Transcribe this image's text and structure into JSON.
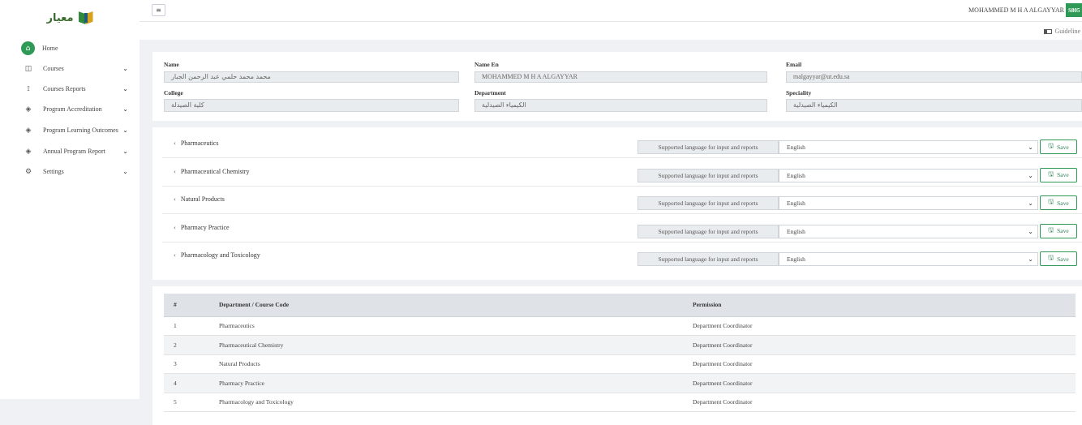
{
  "app": {
    "logo_text": "معيار",
    "brand_colors": {
      "green": "#2e9a55",
      "gold": "#d8a21d"
    }
  },
  "sidebar": {
    "items": [
      {
        "label": "Home",
        "icon": "home-icon",
        "glyph": "⌂",
        "active": true,
        "expandable": false
      },
      {
        "label": "Courses",
        "icon": "book-icon",
        "glyph": "◫",
        "expandable": true
      },
      {
        "label": "Courses Reports",
        "icon": "report-icon",
        "glyph": "⟟",
        "expandable": true
      },
      {
        "label": "Program Accreditation",
        "icon": "layers-icon",
        "glyph": "◈",
        "expandable": true
      },
      {
        "label": "Program Learning Outcomes",
        "icon": "layers-icon",
        "glyph": "◈",
        "expandable": true
      },
      {
        "label": "Annual Program Report",
        "icon": "layers-icon",
        "glyph": "◈",
        "expandable": true
      },
      {
        "label": "Settings",
        "icon": "gear-icon",
        "glyph": "⚙",
        "expandable": true
      }
    ],
    "chevron": "⌄"
  },
  "header": {
    "menu_toggle": "≡",
    "user_name": "MOHAMMED M H A ALGAYYAR",
    "user_badge": "S805",
    "guideline": "Guideline"
  },
  "profile": {
    "name_label": "Name",
    "name_value": "محمد محمد حلمي عبد الرحمن الجبار",
    "name_en_label": "Name En",
    "name_en_value": "MOHAMMED M H A ALGAYYAR",
    "email_label": "Email",
    "email_value": "malgayyar@ut.edu.sa",
    "college_label": "College",
    "college_value": "كلية الصيدلة",
    "department_label": "Department",
    "department_value": "الكيمياء الصيدلية",
    "speciality_label": "Speciality",
    "speciality_value": "الكيمياء الصيدلية"
  },
  "languages": {
    "prefix": "Supported language for input and reports",
    "save_label": "Save",
    "arrow": "‹",
    "rows": [
      {
        "name": "Pharmaceutics",
        "selected": "English"
      },
      {
        "name": "Pharmaceutical Chemistry",
        "selected": "English"
      },
      {
        "name": "Natural Products",
        "selected": "English"
      },
      {
        "name": "Pharmacy Practice",
        "selected": "English"
      },
      {
        "name": "Pharmacology and Toxicology",
        "selected": "English"
      }
    ]
  },
  "permissions": {
    "headers": [
      "#",
      "Department / Course Code",
      "Permission"
    ],
    "rows": [
      [
        "1",
        "Pharmaceutics",
        "Department Coordinator"
      ],
      [
        "2",
        "Pharmaceutical Chemistry",
        "Department Coordinator"
      ],
      [
        "3",
        "Natural Products",
        "Department Coordinator"
      ],
      [
        "4",
        "Pharmacy Practice",
        "Department Coordinator"
      ],
      [
        "5",
        "Pharmacology and Toxicology",
        "Department Coordinator"
      ]
    ]
  }
}
